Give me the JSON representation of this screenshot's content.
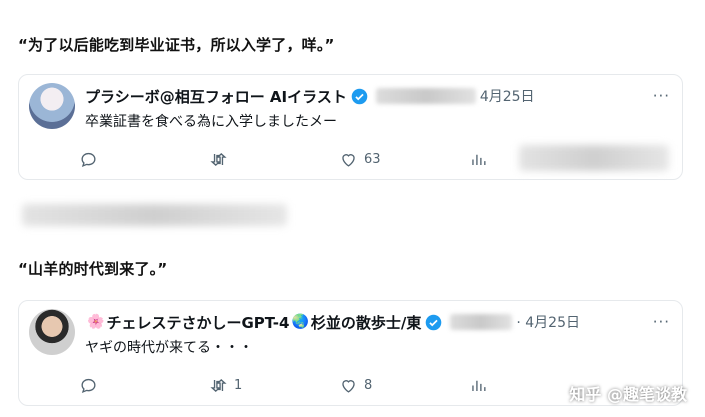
{
  "quote1": "“为了以后能吃到毕业证书，所以入学了，咩。”",
  "quote2": "“山羊的时代到来了。”",
  "tweet1": {
    "name": "プラシーボ@相互フォロー AIイラスト",
    "date": "4月25日",
    "text": "卒業証書を食べる為に入学しましたメー",
    "counts": {
      "reply": "",
      "retweet": "",
      "like": "63"
    }
  },
  "tweet2": {
    "emoji_left": "🌸",
    "name_a": "チェレステさかしーGPT-4",
    "emoji_mid": "🌏",
    "name_b": "杉並の散歩士/東",
    "date": "· 4月25日",
    "text": "ヤギの時代が来てる・・・",
    "counts": {
      "reply": "",
      "retweet": "1",
      "like": "8"
    }
  },
  "more_label": "···",
  "watermark": "知乎 @趣笔谈教",
  "colors": {
    "verified": "#1d9bf0",
    "muted": "#536471",
    "text": "#0f1419"
  },
  "icons": [
    "reply-icon",
    "retweet-icon",
    "like-icon",
    "views-icon",
    "verified-badge-icon",
    "more-icon"
  ]
}
